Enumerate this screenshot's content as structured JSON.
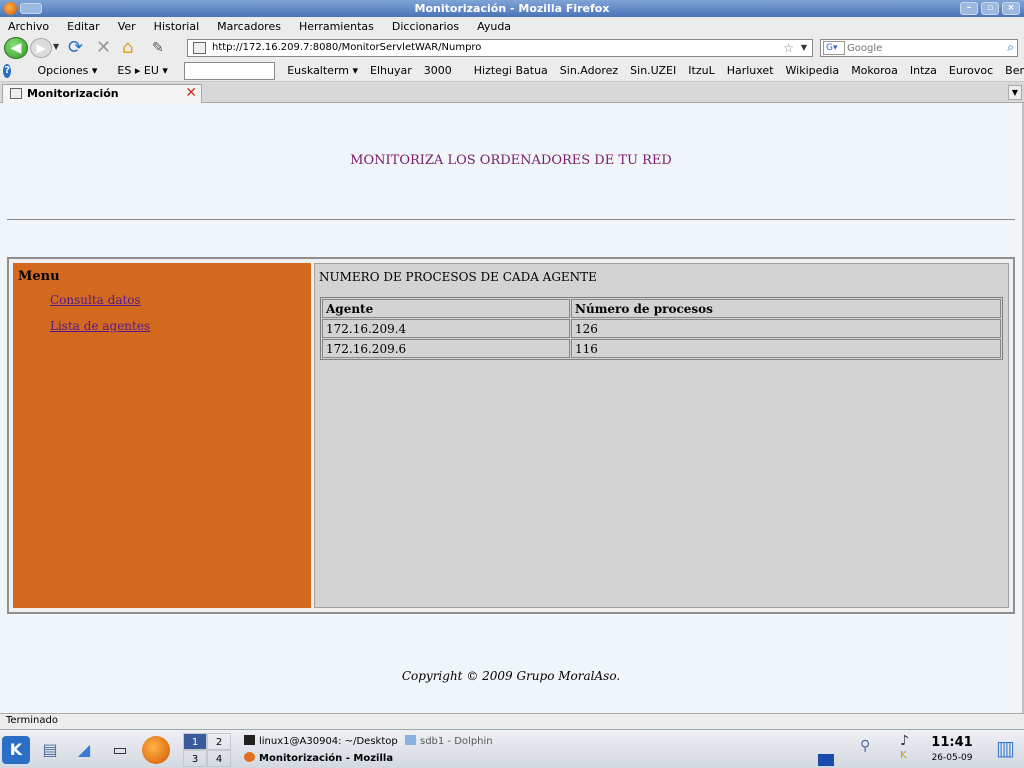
{
  "window": {
    "title": "Monitorización - Mozilla Firefox",
    "buttons": [
      "–",
      "▫",
      "×"
    ]
  },
  "menubar": [
    "Archivo",
    "Editar",
    "Ver",
    "Historial",
    "Marcadores",
    "Herramientas",
    "Diccionarios",
    "Ayuda"
  ],
  "navbar": {
    "url": "http://172.16.209.7:8080/MonitorServletWAR/Numpro",
    "search_placeholder": "Google"
  },
  "bookmarks": [
    "Opciones ▾",
    "ES ▸ EU ▾",
    "Euskalterm ▾",
    "Elhuyar",
    "3000",
    "Hiztegi Batua",
    "Sin.Adorez",
    "Sin.UZEI",
    "ItzuL",
    "Harluxet",
    "Wikipedia",
    "Mokoroa",
    "Intza",
    "Eurovoc",
    "Ber"
  ],
  "tab": {
    "label": "Monitorización"
  },
  "page": {
    "header": "MONITORIZA LOS ORDENADORES DE TU RED",
    "menu_title": "Menu",
    "menu_links": [
      "Consulta datos",
      "Lista de agentes"
    ],
    "main_title": "NUMERO DE PROCESOS DE CADA AGENTE",
    "table": {
      "columns": [
        "Agente",
        "Número de procesos"
      ],
      "rows": [
        [
          "172.16.209.4",
          "126"
        ],
        [
          "172.16.209.6",
          "116"
        ]
      ]
    },
    "copyright": "Copyright © 2009 Grupo MoralAso."
  },
  "statusbar": {
    "text": "Terminado"
  },
  "taskbar": {
    "pager": [
      "1",
      "2",
      "3",
      "4"
    ],
    "tasks": [
      "linux1@A30904: ~/Desktop",
      "sdb1 - Dolphin",
      "Monitorización - Mozilla"
    ],
    "time": "11:41",
    "date": "26-05-09"
  },
  "colors": {
    "menu_bg": "#d2691e",
    "header_text": "#7a1a6e",
    "link": "#551a8b",
    "page_bg": "#f0f5fa"
  }
}
